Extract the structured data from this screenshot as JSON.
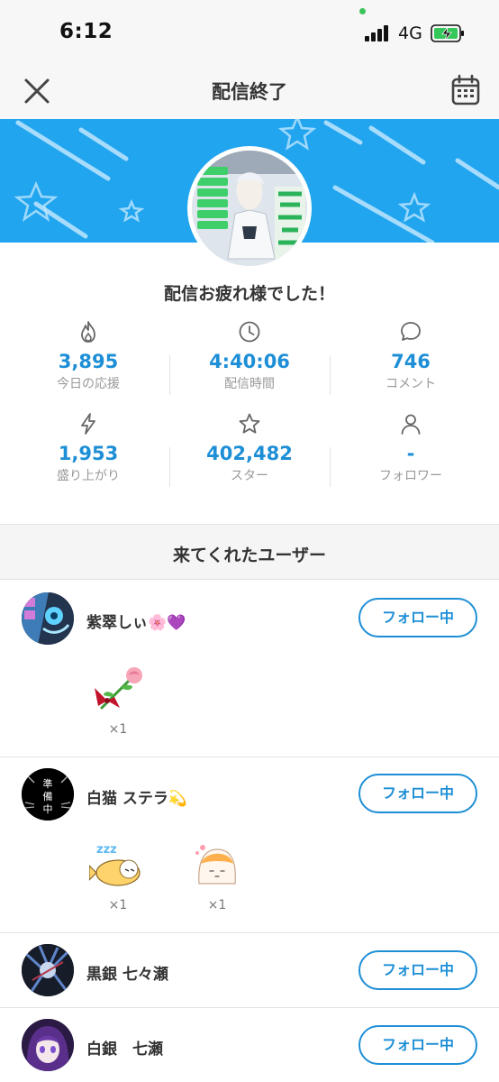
{
  "status_bar": {
    "time": "6:12",
    "network": "4G"
  },
  "header": {
    "title": "配信終了"
  },
  "broadcast": {
    "thanks_message": "配信お疲れ様でした！"
  },
  "stats": [
    {
      "icon": "flame-icon",
      "value": "3,895",
      "label": "今日の応援"
    },
    {
      "icon": "clock-icon",
      "value": "4:40:06",
      "label": "配信時間"
    },
    {
      "icon": "comment-icon",
      "value": "746",
      "label": "コメント"
    },
    {
      "icon": "lightning-icon",
      "value": "1,953",
      "label": "盛り上がり"
    },
    {
      "icon": "star-icon",
      "value": "402,482",
      "label": "スター"
    },
    {
      "icon": "person-icon",
      "value": "-",
      "label": "フォロワー"
    }
  ],
  "visitors": {
    "title": "来てくれたユーザー",
    "users": [
      {
        "name": "紫翠しぃ🌸💜",
        "follow_label": "フォロー中",
        "gifts": [
          {
            "icon": "rose-gift-icon",
            "count": "×1"
          }
        ]
      },
      {
        "name": "白猫 ステラ💫",
        "follow_label": "フォロー中",
        "gifts": [
          {
            "icon": "sleeping-fish-gift-icon",
            "count": "×1"
          },
          {
            "icon": "blob-gift-icon",
            "count": "×1"
          }
        ]
      },
      {
        "name": "黒銀 七々瀬",
        "follow_label": "フォロー中",
        "gifts": []
      },
      {
        "name": "白銀　七瀬",
        "follow_label": "フォロー中",
        "gifts": []
      }
    ]
  },
  "colors": {
    "accent": "#1e8fd6",
    "banner": "#21a5ee",
    "muted": "#999999"
  }
}
